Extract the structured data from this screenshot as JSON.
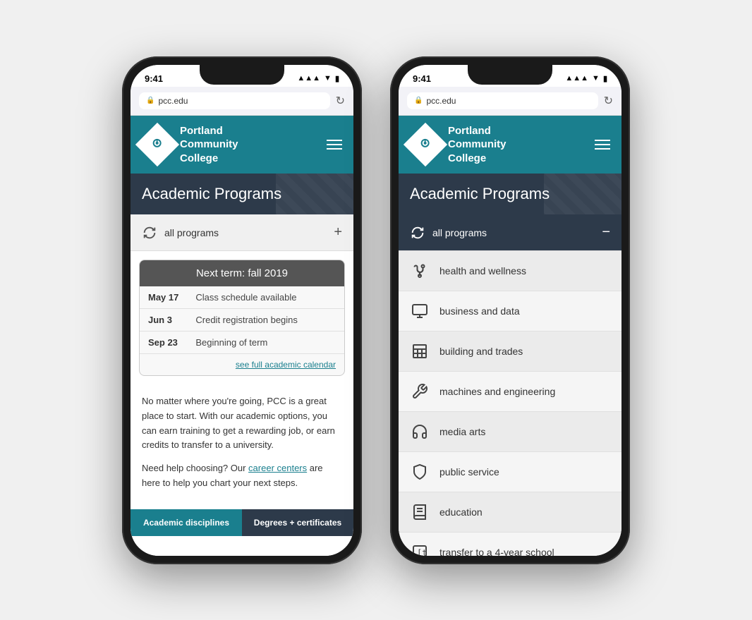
{
  "app": {
    "time": "9:41",
    "url": "pcc.edu",
    "college_name_line1": "Portland",
    "college_name_line2": "Community",
    "college_name_line3": "College",
    "page_title": "Academic Programs"
  },
  "left_phone": {
    "all_programs_label": "all programs",
    "calendar": {
      "header": "Next term: fall 2019",
      "rows": [
        {
          "date": "May 17",
          "event": "Class schedule available"
        },
        {
          "date": "Jun 3",
          "event": "Credit registration begins"
        },
        {
          "date": "Sep 23",
          "event": "Beginning of term"
        }
      ],
      "link": "see full academic calendar"
    },
    "body_text_1": "No matter where you're going, PCC is a great place to start. With our academic options, you can earn training to get a rewarding job, or earn credits to transfer to a university.",
    "body_text_2": "Need help choosing? Our ",
    "body_link": "career centers",
    "body_text_3": " are here to help you chart your next steps.",
    "btn1": "Academic disciplines",
    "btn2": "Degrees + certificates"
  },
  "right_phone": {
    "all_programs_label": "all programs",
    "categories": [
      {
        "id": "health",
        "label": "health and wellness",
        "icon": "stethoscope"
      },
      {
        "id": "business",
        "label": "business and data",
        "icon": "monitor"
      },
      {
        "id": "building",
        "label": "building and trades",
        "icon": "building"
      },
      {
        "id": "machines",
        "label": "machines and engineering",
        "icon": "wrench"
      },
      {
        "id": "media",
        "label": "media arts",
        "icon": "headphones"
      },
      {
        "id": "public",
        "label": "public service",
        "icon": "shield"
      },
      {
        "id": "education",
        "label": "education",
        "icon": "book"
      },
      {
        "id": "transfer",
        "label": "transfer to a 4-year school",
        "icon": "bracket-t"
      }
    ]
  }
}
